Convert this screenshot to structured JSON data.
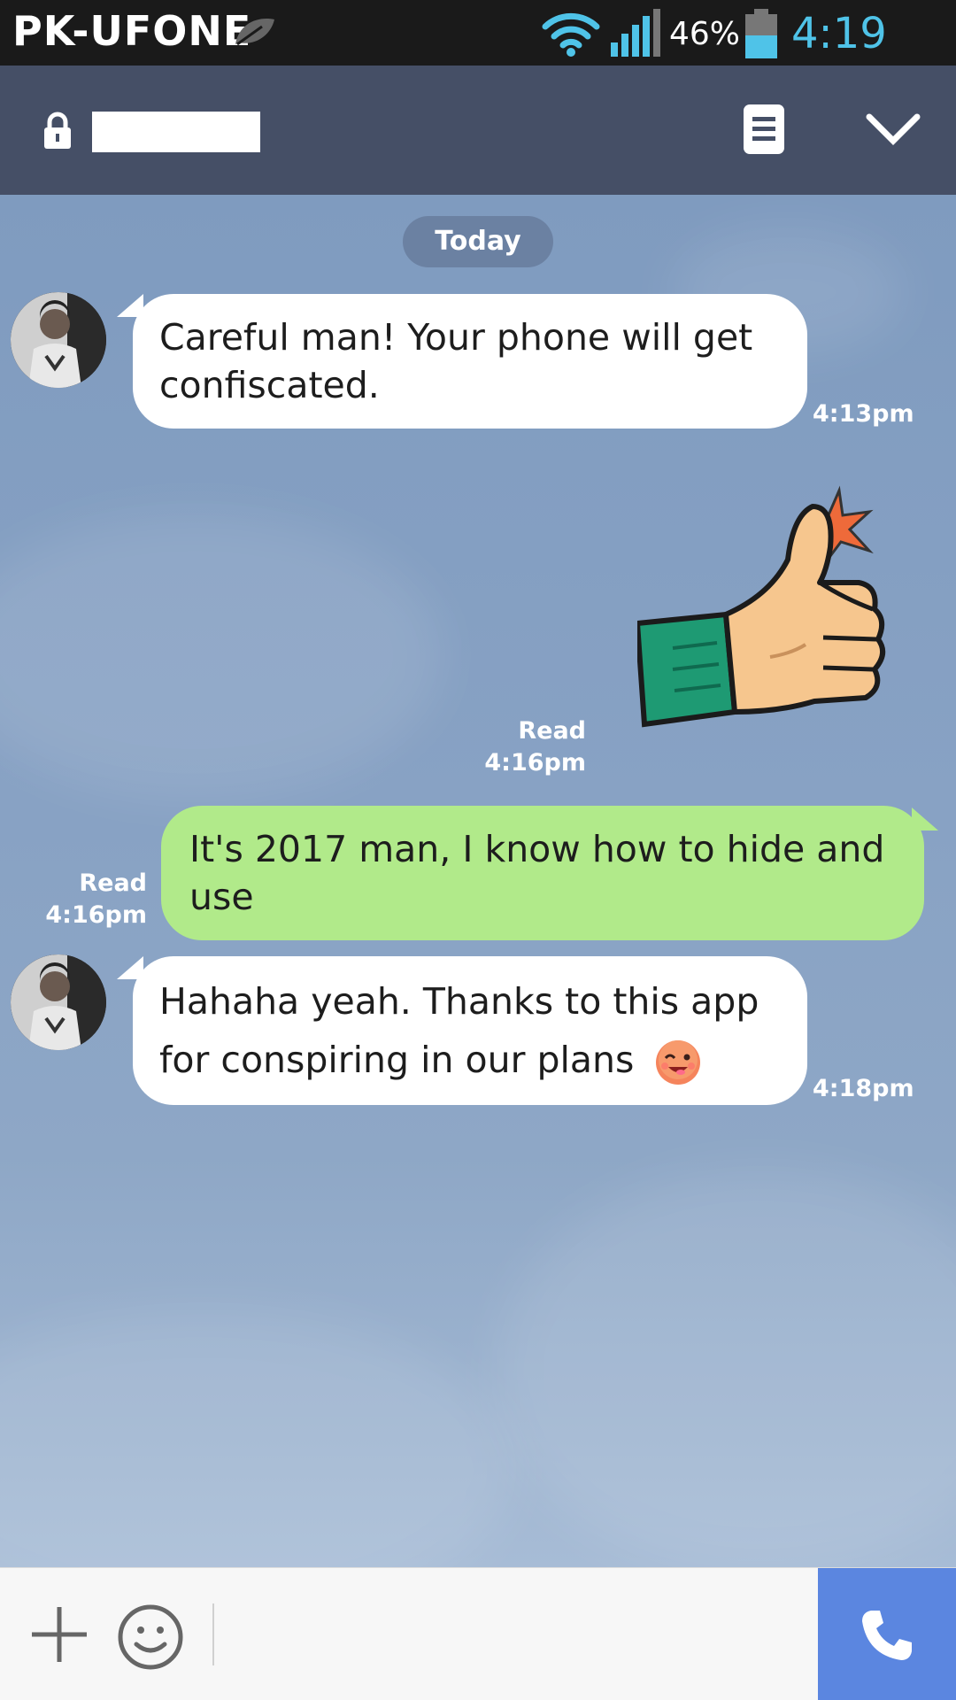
{
  "status_bar": {
    "carrier": "PK-UFONE",
    "battery_percent": "46%",
    "time": "4:19 PM",
    "icons": [
      "leaf-icon",
      "wifi-icon",
      "signal-icon",
      "battery-icon"
    ],
    "time_color": "#4fc3e8"
  },
  "header": {
    "contact_name": "",
    "icons": [
      "lock-icon",
      "note-icon",
      "chevron-down-icon"
    ],
    "background": "#454f66"
  },
  "chat": {
    "date_label": "Today",
    "messages": [
      {
        "direction": "incoming",
        "text": "Careful man! Your phone will get confiscated.",
        "time": "4:13pm"
      },
      {
        "direction": "outgoing",
        "type": "sticker",
        "sticker": "thumbs-up-sticker",
        "read": "Read",
        "time": "4:16pm"
      },
      {
        "direction": "outgoing",
        "text": "It's 2017 man, I know how to hide and use",
        "read": "Read",
        "time": "4:16pm"
      },
      {
        "direction": "incoming",
        "text": "Hahaha yeah. Thanks to this app for conspiring in our plans",
        "emoji": "winking-face-icon",
        "time": "4:18pm"
      }
    ],
    "outgoing_bubble_color": "#b1ea8a",
    "incoming_bubble_color": "#ffffff"
  },
  "input_bar": {
    "placeholder": "",
    "icons": [
      "plus-icon",
      "smile-icon",
      "phone-icon"
    ],
    "call_button_color": "#5b86e0"
  }
}
